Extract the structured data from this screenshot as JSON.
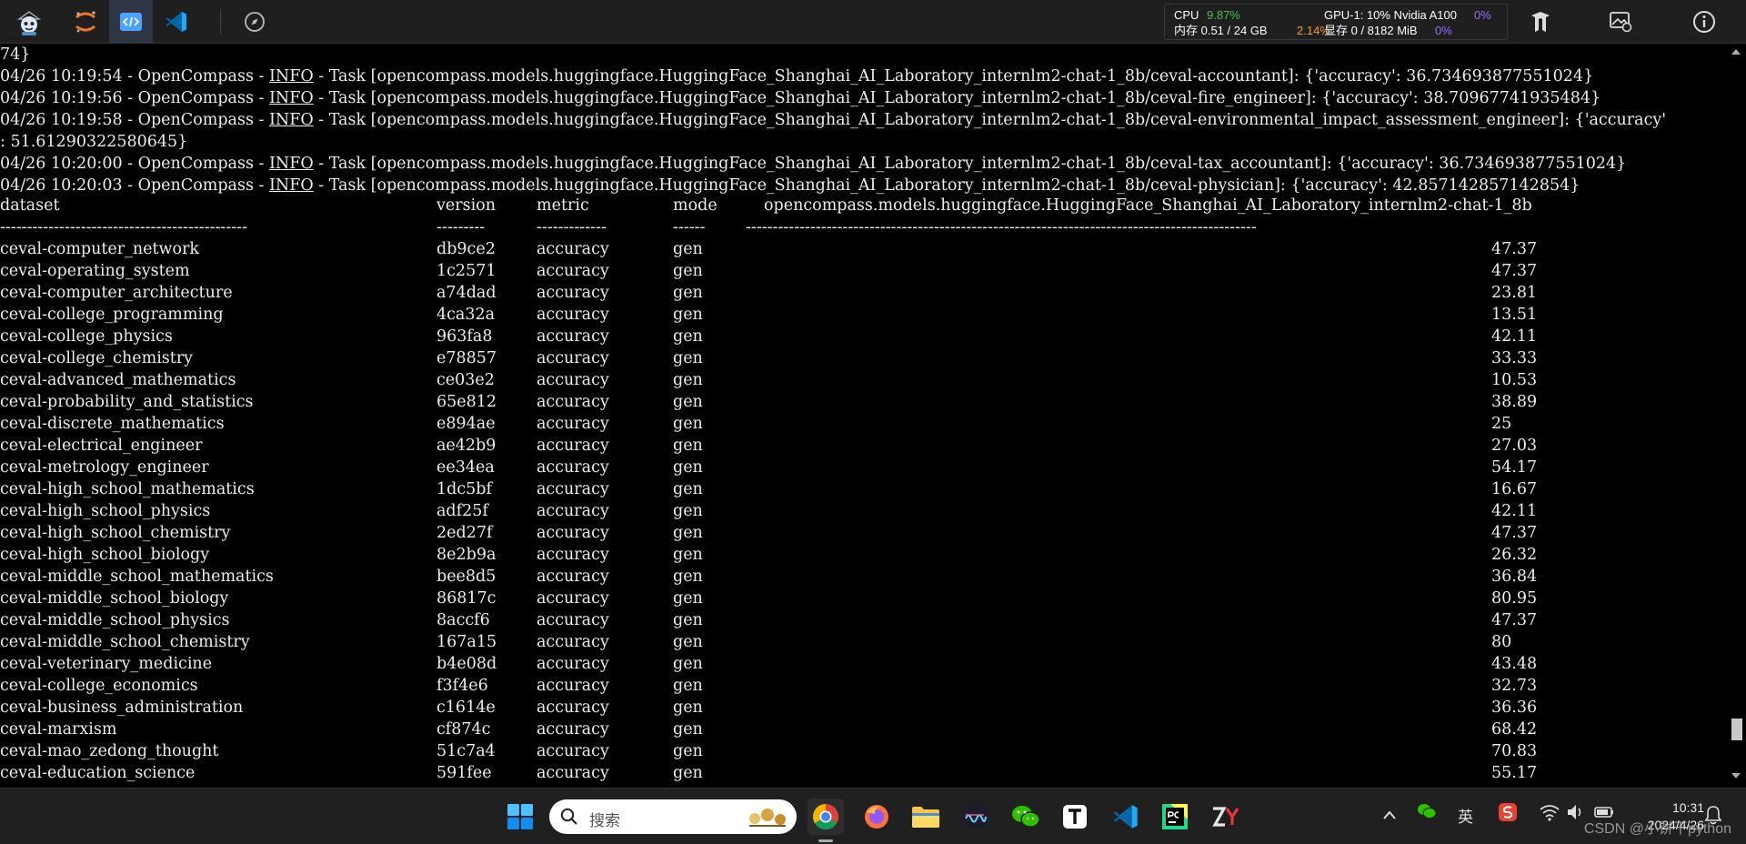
{
  "topbar": {
    "cpu_label": "CPU",
    "cpu_value": "9.87%",
    "mem_label": "内存 0.51 / 24 GB",
    "mem_value": "2.14%",
    "gpu_label": "GPU-1: 10% Nvidia A100",
    "gpu_value": "0%",
    "vram_label": "显存 0 / 8182 MiB",
    "vram_value": "0%"
  },
  "terminal": {
    "log_lines": [
      {
        "pre": "74}",
        "info": "",
        "post": ""
      },
      {
        "pre": "04/26 10:19:54 - OpenCompass - ",
        "info": "INFO",
        "post": " - Task [opencompass.models.huggingface.HuggingFace_Shanghai_AI_Laboratory_internlm2-chat-1_8b/ceval-accountant]: {'accuracy': 36.734693877551024}"
      },
      {
        "pre": "04/26 10:19:56 - OpenCompass - ",
        "info": "INFO",
        "post": " - Task [opencompass.models.huggingface.HuggingFace_Shanghai_AI_Laboratory_internlm2-chat-1_8b/ceval-fire_engineer]: {'accuracy': 38.70967741935484}"
      },
      {
        "pre": "04/26 10:19:58 - OpenCompass - ",
        "info": "INFO",
        "post": " - Task [opencompass.models.huggingface.HuggingFace_Shanghai_AI_Laboratory_internlm2-chat-1_8b/ceval-environmental_impact_assessment_engineer]: {'accuracy'"
      },
      {
        "pre": ": 51.61290322580645}",
        "info": "",
        "post": ""
      },
      {
        "pre": "04/26 10:20:00 - OpenCompass - ",
        "info": "INFO",
        "post": " - Task [opencompass.models.huggingface.HuggingFace_Shanghai_AI_Laboratory_internlm2-chat-1_8b/ceval-tax_accountant]: {'accuracy': 36.734693877551024}"
      },
      {
        "pre": "04/26 10:20:03 - OpenCompass - ",
        "info": "INFO",
        "post": " - Task [opencompass.models.huggingface.HuggingFace_Shanghai_AI_Laboratory_internlm2-chat-1_8b/ceval-physician]: {'accuracy': 42.857142857142854}"
      }
    ],
    "table": {
      "headers": [
        "dataset",
        "version",
        "metric",
        "mode",
        "opencompass.models.huggingface.HuggingFace_Shanghai_AI_Laboratory_internlm2-chat-1_8b"
      ],
      "separators": [
        "----------------------------------------------",
        "---------",
        "-------------",
        "------",
        "-----------------------------------------------------------------------------------------------"
      ],
      "rows": [
        [
          "ceval-computer_network",
          "db9ce2",
          "accuracy",
          "gen",
          "47.37"
        ],
        [
          "ceval-operating_system",
          "1c2571",
          "accuracy",
          "gen",
          "47.37"
        ],
        [
          "ceval-computer_architecture",
          "a74dad",
          "accuracy",
          "gen",
          "23.81"
        ],
        [
          "ceval-college_programming",
          "4ca32a",
          "accuracy",
          "gen",
          "13.51"
        ],
        [
          "ceval-college_physics",
          "963fa8",
          "accuracy",
          "gen",
          "42.11"
        ],
        [
          "ceval-college_chemistry",
          "e78857",
          "accuracy",
          "gen",
          "33.33"
        ],
        [
          "ceval-advanced_mathematics",
          "ce03e2",
          "accuracy",
          "gen",
          "10.53"
        ],
        [
          "ceval-probability_and_statistics",
          "65e812",
          "accuracy",
          "gen",
          "38.89"
        ],
        [
          "ceval-discrete_mathematics",
          "e894ae",
          "accuracy",
          "gen",
          "25"
        ],
        [
          "ceval-electrical_engineer",
          "ae42b9",
          "accuracy",
          "gen",
          "27.03"
        ],
        [
          "ceval-metrology_engineer",
          "ee34ea",
          "accuracy",
          "gen",
          "54.17"
        ],
        [
          "ceval-high_school_mathematics",
          "1dc5bf",
          "accuracy",
          "gen",
          "16.67"
        ],
        [
          "ceval-high_school_physics",
          "adf25f",
          "accuracy",
          "gen",
          "42.11"
        ],
        [
          "ceval-high_school_chemistry",
          "2ed27f",
          "accuracy",
          "gen",
          "47.37"
        ],
        [
          "ceval-high_school_biology",
          "8e2b9a",
          "accuracy",
          "gen",
          "26.32"
        ],
        [
          "ceval-middle_school_mathematics",
          "bee8d5",
          "accuracy",
          "gen",
          "36.84"
        ],
        [
          "ceval-middle_school_biology",
          "86817c",
          "accuracy",
          "gen",
          "80.95"
        ],
        [
          "ceval-middle_school_physics",
          "8accf6",
          "accuracy",
          "gen",
          "47.37"
        ],
        [
          "ceval-middle_school_chemistry",
          "167a15",
          "accuracy",
          "gen",
          "80"
        ],
        [
          "ceval-veterinary_medicine",
          "b4e08d",
          "accuracy",
          "gen",
          "43.48"
        ],
        [
          "ceval-college_economics",
          "f3f4e6",
          "accuracy",
          "gen",
          "32.73"
        ],
        [
          "ceval-business_administration",
          "c1614e",
          "accuracy",
          "gen",
          "36.36"
        ],
        [
          "ceval-marxism",
          "cf874c",
          "accuracy",
          "gen",
          "68.42"
        ],
        [
          "ceval-mao_zedong_thought",
          "51c7a4",
          "accuracy",
          "gen",
          "70.83"
        ],
        [
          "ceval-education_science",
          "591fee",
          "accuracy",
          "gen",
          "55.17"
        ]
      ]
    }
  },
  "taskbar": {
    "search_placeholder": "搜索",
    "ime_label": "英",
    "time": "10:31",
    "date": "2024/4/26",
    "watermark": "CSDN @小饼干python",
    "icons": [
      "windows-start-icon",
      "search-icon",
      "chrome-icon",
      "firefox-icon",
      "file-explorer-icon",
      "audio-wave-icon",
      "wechat-icon",
      "typora-icon",
      "vscode-icon",
      "pycharm-icon",
      "zy-icon"
    ]
  },
  "colors": {
    "terminal_bg": "#000000",
    "terminal_text": "#ececec",
    "topbar_bg": "#1f1f1f",
    "taskbar_bg": "#202020",
    "accent_green": "#3fc24d",
    "accent_orange": "#f19a38",
    "accent_purple": "#9c6bff"
  }
}
